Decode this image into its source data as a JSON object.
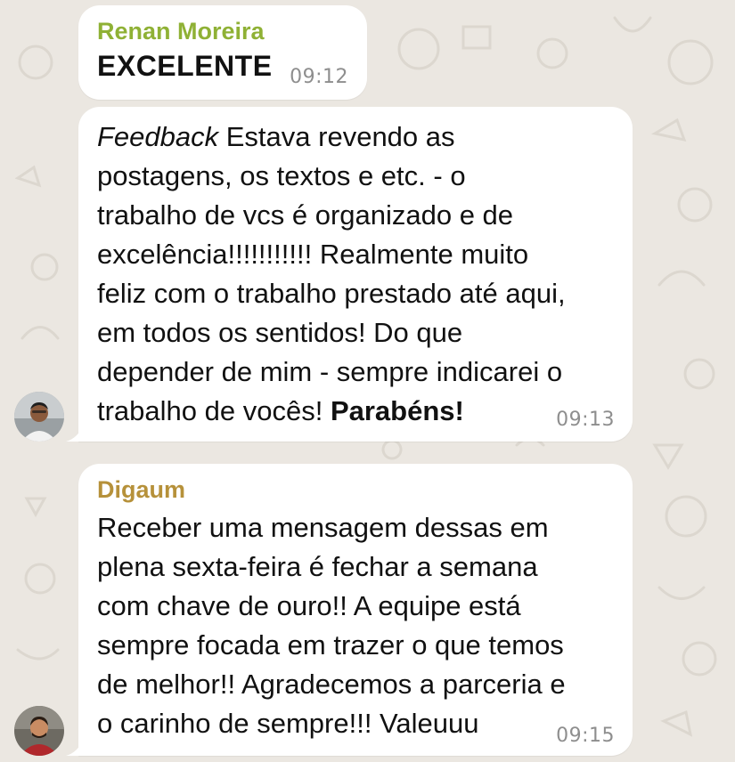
{
  "messages": [
    {
      "sender": "Renan Moreira",
      "text": "EXCELENTE",
      "time": "09:12"
    },
    {
      "text_italic": "Feedback",
      "text_main": " Estava revendo as\npostagens, os textos e etc. - o\ntrabalho de vcs é organizado e de\nexcelência!!!!!!!!!!! Realmente muito\nfeliz com o trabalho prestado até aqui,\nem todos os sentidos! Do que\ndepender de mim - sempre indicarei o\ntrabalho de vocês! ",
      "text_bold": "Parabéns!",
      "time": "09:13"
    },
    {
      "sender": "Digaum",
      "text": "Receber uma mensagem dessas em\nplena sexta-feira é fechar a semana\ncom chave de ouro!! A equipe está\nsempre focada em trazer o que temos\nde melhor!! Agradecemos a parceria e\no carinho de sempre!!! Valeuuu",
      "time": "09:15"
    }
  ],
  "colors": {
    "background": "#ebe7e1",
    "bubble": "#ffffff",
    "sender_renan": "#8fb135",
    "sender_digaum": "#b6913a",
    "timestamp": "#8e8e8e"
  }
}
